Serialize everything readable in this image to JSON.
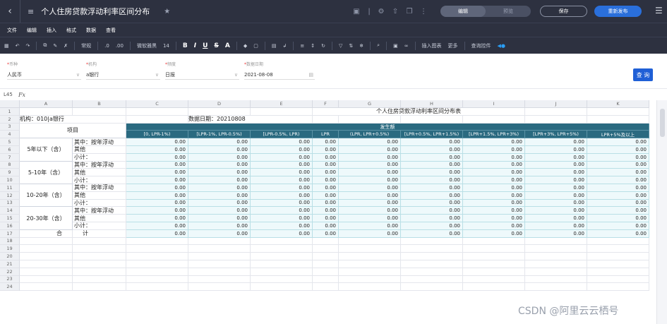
{
  "titlebar": {
    "title": "个人住房贷款浮动利率区间分布",
    "back_icon": "chevron-left-icon",
    "doc_icon": "document-icon",
    "star_icon": "star-icon",
    "modes": [
      "编辑",
      "预览"
    ],
    "active_mode": "编辑",
    "save_label": "保存",
    "publish_label": "重新发布",
    "accent_color": "#2a6fdb"
  },
  "menubar": {
    "items": [
      "文件",
      "编辑",
      "插入",
      "格式",
      "数据",
      "查看"
    ]
  },
  "toolbar": {
    "format_label": "常规",
    "font_name": "微软雅黑",
    "font_size": "14",
    "bold": "B",
    "italic": "I",
    "underline": "U",
    "strike": "S",
    "color_a": "A",
    "insert_chart": "插入图表",
    "more": "更多",
    "query_control": "查询控件"
  },
  "params": [
    {
      "label": "币种",
      "required": true,
      "value": "人民币"
    },
    {
      "label": "机构",
      "required": true,
      "value": "a银行"
    },
    {
      "label": "频度",
      "required": true,
      "value": "日报"
    },
    {
      "label": "数据日期",
      "required": true,
      "value": "2021-08-08"
    }
  ],
  "query_button": "查 询",
  "formula": {
    "cell_ref": "L45",
    "fx": "Fx"
  },
  "columns": [
    "A",
    "B",
    "C",
    "D",
    "E",
    "F",
    "G",
    "H",
    "I",
    "J",
    "K"
  ],
  "rows_count": 24,
  "sheet": {
    "title": "个人住房贷款浮动利率区间分布表",
    "org": "机构：010|a银行",
    "date": "数据日期：20210808",
    "item_header": "项目",
    "amount_header": "发生额",
    "range_headers": [
      "[0, LPR-1%)",
      "[LPR-1%, LPR-0.5%)",
      "[LPR-0.5%, LPR)",
      "LPR",
      "(LPR, LPR+0.5%)",
      "[LPR+0.5%, LPR+1.5%)",
      "[LPR+1.5%, LPR+3%)",
      "[LPR+3%, LPR+5%)",
      "LPR+5%及以上"
    ],
    "groups": [
      {
        "label": "5年以下（含）",
        "subs": [
          "其中：按年浮动",
          "其他",
          "小计："
        ]
      },
      {
        "label": "5-10年（含）",
        "subs": [
          "其中：按年浮动",
          "其他",
          "小计："
        ]
      },
      {
        "label": "10-20年（含）",
        "subs": [
          "其中：按年浮动",
          "其他",
          "小计："
        ]
      },
      {
        "label": "20-30年（含）",
        "subs": [
          "其中：按年浮动",
          "其他",
          "小计："
        ]
      }
    ],
    "total_label_a": "合",
    "total_label_b": "计",
    "value": "0.00"
  },
  "footer": "CSDN @阿里云云栖号"
}
